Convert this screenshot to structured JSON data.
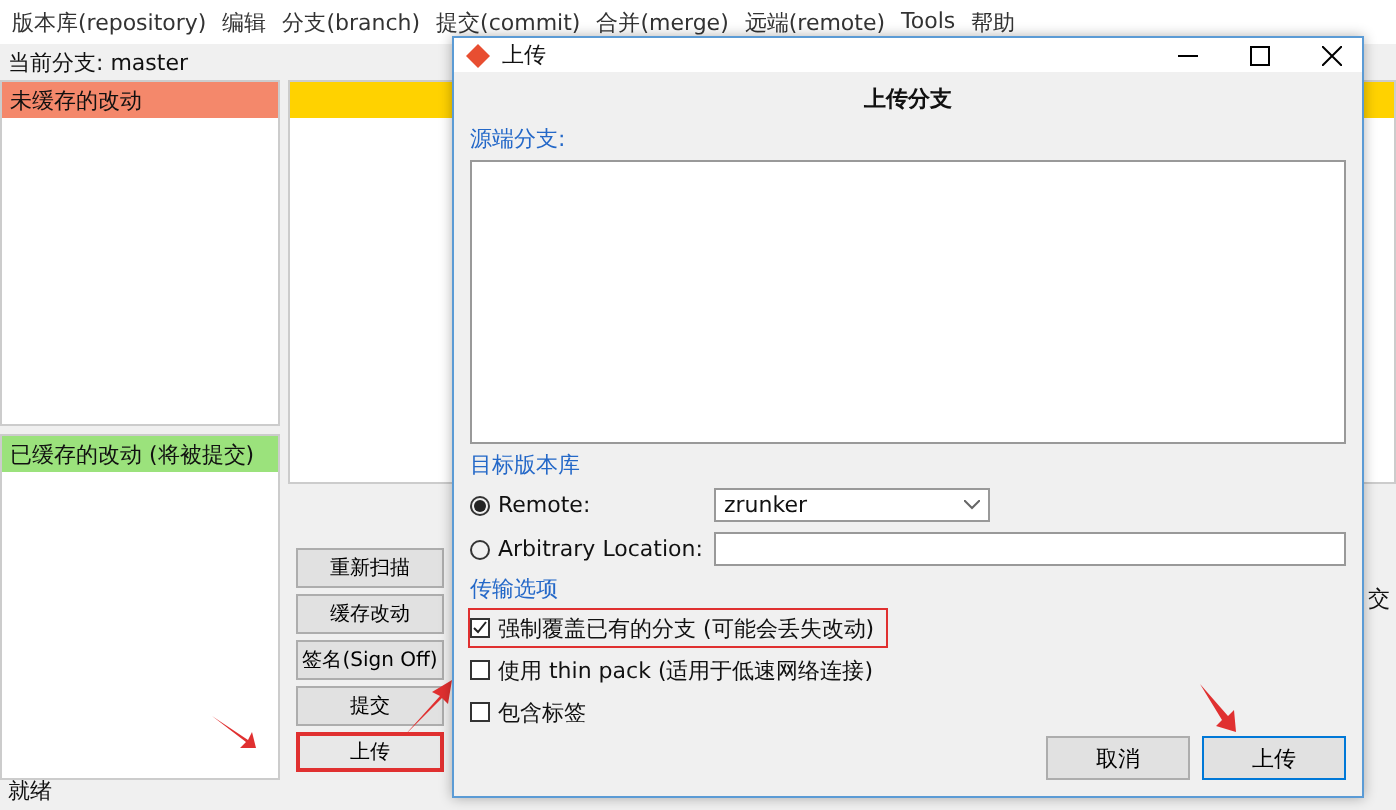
{
  "menu": [
    "版本库(repository)",
    "编辑",
    "分支(branch)",
    "提交(commit)",
    "合并(merge)",
    "远端(remote)",
    "Tools",
    "帮助"
  ],
  "current_branch": "当前分支: master",
  "unstaged": {
    "title": "未缓存的改动"
  },
  "staged": {
    "title": "已缓存的改动 (将被提交)"
  },
  "commit_label_fragment": "交",
  "actions": [
    {
      "label": "重新扫描",
      "highlighted": false
    },
    {
      "label": "缓存改动",
      "highlighted": false
    },
    {
      "label": "签名(Sign Off)",
      "highlighted": false
    },
    {
      "label": "提交",
      "highlighted": false
    },
    {
      "label": "上传",
      "highlighted": true
    }
  ],
  "status_bar": "就绪",
  "dialog": {
    "title": "上传",
    "heading": "上传分支",
    "source_label": "源端分支:",
    "destination": {
      "label": "目标版本库",
      "options": [
        {
          "label": "Remote:",
          "selected": true,
          "kind": "select",
          "value": "zrunker"
        },
        {
          "label": "Arbitrary Location:",
          "selected": false,
          "kind": "input"
        }
      ]
    },
    "transfer": {
      "label": "传输选项",
      "options": [
        {
          "label": "强制覆盖已有的分支 (可能会丢失改动)",
          "checked": true,
          "highlighted": true
        },
        {
          "label": "使用 thin pack (适用于低速网络连接)",
          "checked": false,
          "highlighted": false
        },
        {
          "label": "包含标签",
          "checked": false,
          "highlighted": false
        }
      ]
    },
    "buttons": [
      {
        "label": "取消",
        "default": false
      },
      {
        "label": "上传",
        "default": true
      }
    ]
  }
}
